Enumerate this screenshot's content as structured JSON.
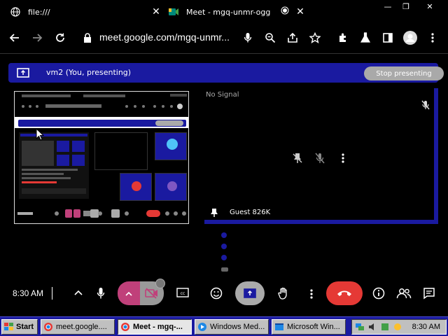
{
  "browser": {
    "tabs": [
      {
        "title": "file:///",
        "icon": "globe-icon"
      },
      {
        "title": "Meet - mgq-unmr-ogg",
        "icon": "meet-icon"
      }
    ],
    "url": "meet.google.com/mgq-unmr..."
  },
  "banner": {
    "presenting_text": "vm2 (You, presenting)",
    "stop_label": "Stop presenting"
  },
  "tiles": {
    "signal_text": "No Signal",
    "guest_name": "Guest 826K"
  },
  "controls": {
    "time": "8:30 AM"
  },
  "taskbar": {
    "start_label": "Start",
    "tasks": [
      {
        "label": "meet.google....",
        "active": false
      },
      {
        "label": "Meet - mgq-...",
        "active": true
      },
      {
        "label": "Windows Med...",
        "active": false
      },
      {
        "label": "Microsoft Win...",
        "active": false
      }
    ],
    "clock": "8:30 AM"
  },
  "colors": {
    "banner": "#1a1aa0",
    "end_call": "#e53935",
    "camera_off": "#c0407a"
  }
}
